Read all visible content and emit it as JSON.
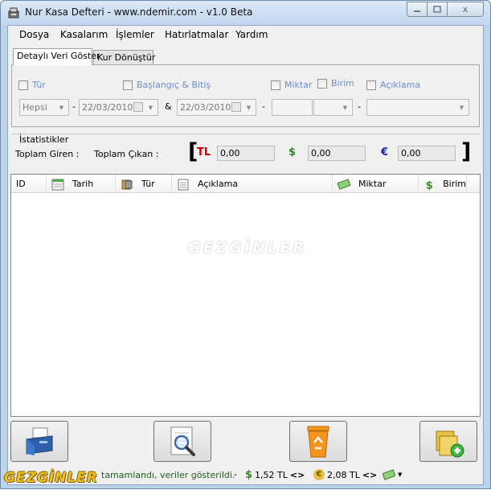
{
  "window": {
    "title": "Nur Kasa Defteri  - www.ndemir.com - v1.0 Beta",
    "close_glyph": "x"
  },
  "menu": [
    "Dosya",
    "Kasalarım",
    "İşlemler",
    "Hatırlatmalar",
    "Yardım"
  ],
  "tabs": [
    "Detaylı Veri Göster",
    "Kur Dönüştür"
  ],
  "filters": {
    "type_label": "Tür",
    "type_value": "Hepsi",
    "date_label": "Başlangıç & Bitiş",
    "date_start": "22/03/2010",
    "date_end": "22/03/2010",
    "date_sep": "&",
    "amount_label": "Miktar",
    "unit_label": "Birim",
    "desc_label": "Açıklama",
    "dash": "-"
  },
  "stats": {
    "title": "İstatistikler",
    "total_in_label": "Toplam Giren :",
    "total_out_label": "Toplam Çıkan :",
    "open_bracket": "[",
    "close_bracket": "]",
    "tl_symbol": "TL",
    "tl_value": "0,00",
    "usd_symbol": "$",
    "usd_value": "0,00",
    "eur_symbol": "€",
    "eur_value": "0,00",
    "colors": {
      "tl": "#cc0000",
      "usd": "#2a8a2a",
      "eur": "#1a2aa0"
    }
  },
  "grid": {
    "columns": [
      "ID",
      "Tarih",
      "Tür",
      "Açıklama",
      "Miktar",
      "Birim"
    ],
    "watermark": "GEZGİNLER"
  },
  "status": {
    "message": "tamamlandı, veriler gösterildi.",
    "dash": "-",
    "usd_rate": "1,52 TL",
    "eur_rate": "2,08 TL"
  },
  "corner_logo": "GEZGİNLER"
}
